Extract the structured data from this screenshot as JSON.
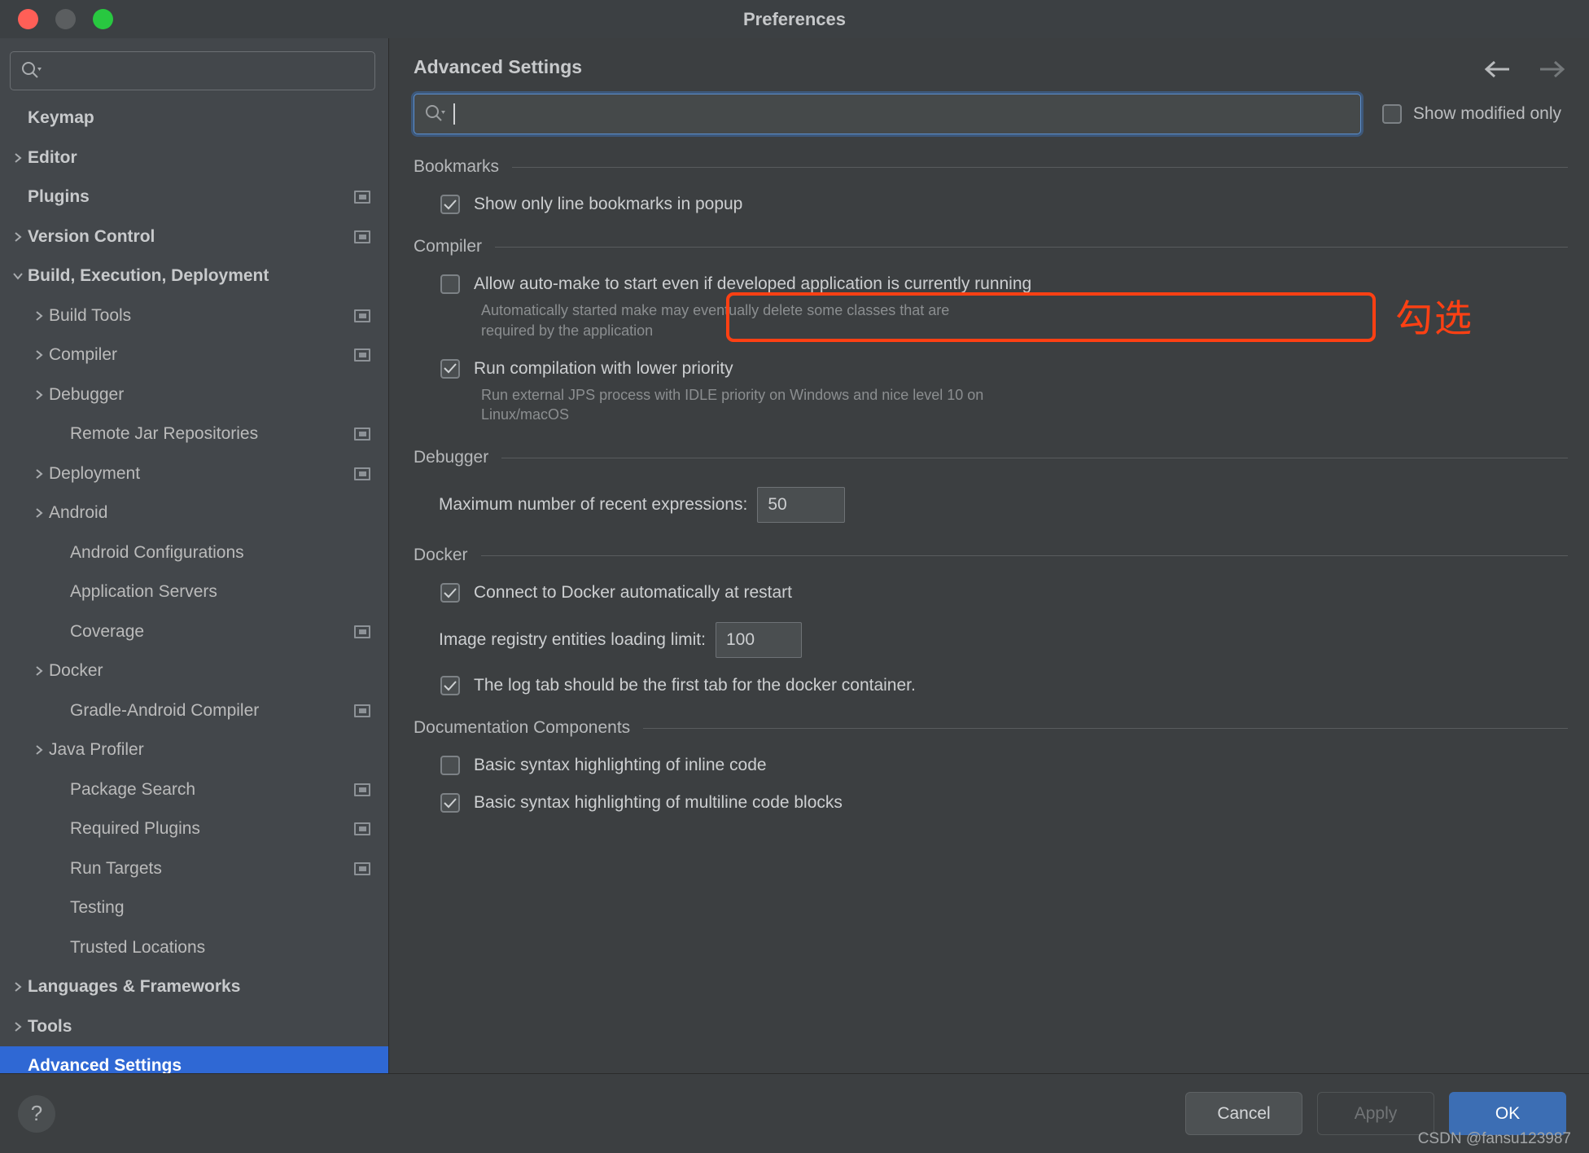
{
  "window": {
    "title": "Preferences",
    "traffic_lights": [
      "close-red",
      "minimize-amber",
      "zoom-green"
    ]
  },
  "sidebar": {
    "search_icon": "search-icon",
    "search_value": "",
    "items": [
      {
        "label": "Keymap",
        "level": 0,
        "arrow": "none",
        "bold": true,
        "badge": false,
        "selected": false
      },
      {
        "label": "Editor",
        "level": 0,
        "arrow": "right",
        "bold": true,
        "badge": false,
        "selected": false
      },
      {
        "label": "Plugins",
        "level": 0,
        "arrow": "none",
        "bold": true,
        "badge": true,
        "selected": false
      },
      {
        "label": "Version Control",
        "level": 0,
        "arrow": "right",
        "bold": true,
        "badge": true,
        "selected": false
      },
      {
        "label": "Build, Execution, Deployment",
        "level": 0,
        "arrow": "down",
        "bold": true,
        "badge": false,
        "selected": false
      },
      {
        "label": "Build Tools",
        "level": 1,
        "arrow": "right",
        "bold": false,
        "badge": true,
        "selected": false
      },
      {
        "label": "Compiler",
        "level": 1,
        "arrow": "right",
        "bold": false,
        "badge": true,
        "selected": false
      },
      {
        "label": "Debugger",
        "level": 1,
        "arrow": "right",
        "bold": false,
        "badge": false,
        "selected": false
      },
      {
        "label": "Remote Jar Repositories",
        "level": 2,
        "arrow": "none",
        "bold": false,
        "badge": true,
        "selected": false
      },
      {
        "label": "Deployment",
        "level": 1,
        "arrow": "right",
        "bold": false,
        "badge": true,
        "selected": false
      },
      {
        "label": "Android",
        "level": 1,
        "arrow": "right",
        "bold": false,
        "badge": false,
        "selected": false
      },
      {
        "label": "Android Configurations",
        "level": 2,
        "arrow": "none",
        "bold": false,
        "badge": false,
        "selected": false
      },
      {
        "label": "Application Servers",
        "level": 2,
        "arrow": "none",
        "bold": false,
        "badge": false,
        "selected": false
      },
      {
        "label": "Coverage",
        "level": 2,
        "arrow": "none",
        "bold": false,
        "badge": true,
        "selected": false
      },
      {
        "label": "Docker",
        "level": 1,
        "arrow": "right",
        "bold": false,
        "badge": false,
        "selected": false
      },
      {
        "label": "Gradle-Android Compiler",
        "level": 2,
        "arrow": "none",
        "bold": false,
        "badge": true,
        "selected": false
      },
      {
        "label": "Java Profiler",
        "level": 1,
        "arrow": "right",
        "bold": false,
        "badge": false,
        "selected": false
      },
      {
        "label": "Package Search",
        "level": 2,
        "arrow": "none",
        "bold": false,
        "badge": true,
        "selected": false
      },
      {
        "label": "Required Plugins",
        "level": 2,
        "arrow": "none",
        "bold": false,
        "badge": true,
        "selected": false
      },
      {
        "label": "Run Targets",
        "level": 2,
        "arrow": "none",
        "bold": false,
        "badge": true,
        "selected": false
      },
      {
        "label": "Testing",
        "level": 2,
        "arrow": "none",
        "bold": false,
        "badge": false,
        "selected": false
      },
      {
        "label": "Trusted Locations",
        "level": 2,
        "arrow": "none",
        "bold": false,
        "badge": false,
        "selected": false
      },
      {
        "label": "Languages & Frameworks",
        "level": 0,
        "arrow": "right",
        "bold": true,
        "badge": false,
        "selected": false
      },
      {
        "label": "Tools",
        "level": 0,
        "arrow": "right",
        "bold": true,
        "badge": false,
        "selected": false
      },
      {
        "label": "Advanced Settings",
        "level": 0,
        "arrow": "none",
        "bold": true,
        "badge": false,
        "selected": true
      }
    ],
    "selection_color": "#2f68d4"
  },
  "main": {
    "page_title": "Advanced Settings",
    "back_icon": "arrow-left-icon",
    "forward_icon": "arrow-right-icon",
    "filter": {
      "icon": "search-icon",
      "value": "",
      "placeholder": ""
    },
    "show_modified_only": {
      "label": "Show modified only",
      "checked": false
    },
    "groups": [
      {
        "title": "Bookmarks",
        "rows": [
          {
            "kind": "checkbox",
            "label": "Show only line bookmarks in popup",
            "checked": true,
            "desc": null
          }
        ]
      },
      {
        "title": "Compiler",
        "rows": [
          {
            "kind": "checkbox",
            "label": "Allow auto-make to start even if developed application is currently running",
            "checked": false,
            "desc": "Automatically started make may eventually delete some classes that are required by the application"
          },
          {
            "kind": "checkbox",
            "label": "Run compilation with lower priority",
            "checked": true,
            "desc": "Run external JPS process with IDLE priority on Windows and nice level 10 on Linux/macOS"
          }
        ]
      },
      {
        "title": "Debugger",
        "rows": [
          {
            "kind": "field",
            "label": "Maximum number of recent expressions:",
            "value": "50",
            "desc": null
          }
        ]
      },
      {
        "title": "Docker",
        "rows": [
          {
            "kind": "checkbox",
            "label": "Connect to Docker automatically at restart",
            "checked": true,
            "desc": null
          },
          {
            "kind": "field",
            "label": "Image registry entities loading limit:",
            "value": "100",
            "desc": null
          },
          {
            "kind": "checkbox",
            "label": "The log tab should be the first tab for the docker container.",
            "checked": true,
            "desc": null
          }
        ]
      },
      {
        "title": "Documentation Components",
        "rows": [
          {
            "kind": "checkbox",
            "label": "Basic syntax highlighting of inline code",
            "checked": false,
            "desc": null
          },
          {
            "kind": "checkbox",
            "label": "Basic syntax highlighting of multiline code blocks",
            "checked": true,
            "desc": null
          }
        ]
      }
    ]
  },
  "annotation": {
    "text": "勾选",
    "color": "#ff4013",
    "highlight_target": "Allow auto-make to start even if developed application is currently running"
  },
  "footer": {
    "help_label": "?",
    "cancel_label": "Cancel",
    "apply_label": "Apply",
    "apply_enabled": false,
    "ok_label": "OK",
    "ok_color": "#3c6eb4",
    "watermark": "CSDN @fansu123987"
  }
}
